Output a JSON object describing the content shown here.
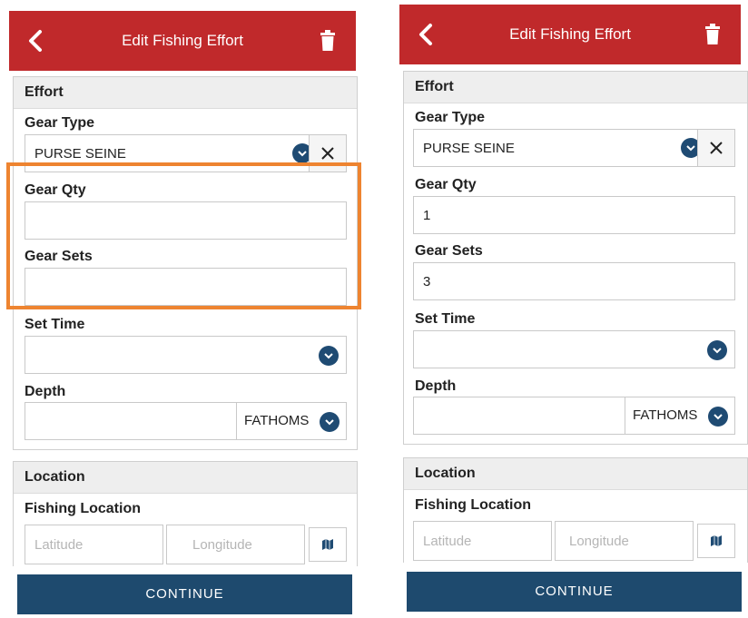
{
  "screens": [
    {
      "header": {
        "title": "Edit Fishing Effort"
      },
      "effort": {
        "heading": "Effort",
        "gear_type": {
          "label": "Gear Type",
          "value": "PURSE SEINE"
        },
        "gear_qty": {
          "label": "Gear Qty",
          "value": ""
        },
        "gear_sets": {
          "label": "Gear Sets",
          "value": ""
        },
        "set_time": {
          "label": "Set Time",
          "value": ""
        },
        "depth": {
          "label": "Depth",
          "value": "",
          "unit": "FATHOMS"
        }
      },
      "location": {
        "heading": "Location",
        "fishing_location": {
          "label": "Fishing Location"
        },
        "latitude_placeholder": "Latitude",
        "longitude_placeholder": "Longitude"
      },
      "continue_label": "CONTINUE"
    },
    {
      "header": {
        "title": "Edit Fishing Effort"
      },
      "effort": {
        "heading": "Effort",
        "gear_type": {
          "label": "Gear Type",
          "value": "PURSE SEINE"
        },
        "gear_qty": {
          "label": "Gear Qty",
          "value": "1"
        },
        "gear_sets": {
          "label": "Gear Sets",
          "value": "3"
        },
        "set_time": {
          "label": "Set Time",
          "value": ""
        },
        "depth": {
          "label": "Depth",
          "value": "",
          "unit": "FATHOMS"
        }
      },
      "location": {
        "heading": "Location",
        "fishing_location": {
          "label": "Fishing Location"
        },
        "latitude_placeholder": "Latitude",
        "longitude_placeholder": "Longitude"
      },
      "continue_label": "CONTINUE"
    }
  ],
  "colors": {
    "header": "#c0292b",
    "button": "#1e4a6e",
    "chevron": "#1f4b73",
    "highlight": "#ee8430"
  },
  "icons": [
    "back-icon",
    "trash-icon",
    "chevron-down-icon",
    "close-icon",
    "map-icon"
  ]
}
